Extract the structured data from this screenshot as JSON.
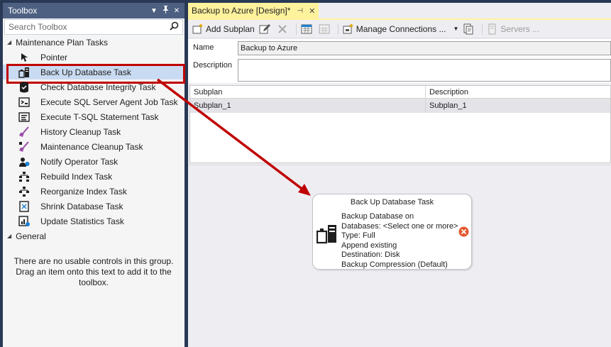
{
  "toolbox": {
    "title": "Toolbox",
    "search_placeholder": "Search Toolbox",
    "groups": [
      {
        "label": "Maintenance Plan Tasks",
        "items": [
          {
            "label": "Pointer",
            "icon": "pointer-icon"
          },
          {
            "label": "Back Up Database Task",
            "icon": "backup-database-icon",
            "selected": true
          },
          {
            "label": "Check Database Integrity Task",
            "icon": "check-integrity-icon"
          },
          {
            "label": "Execute SQL Server Agent Job Task",
            "icon": "agent-job-icon"
          },
          {
            "label": "Execute T-SQL Statement Task",
            "icon": "tsql-statement-icon"
          },
          {
            "label": "History Cleanup Task",
            "icon": "history-cleanup-icon"
          },
          {
            "label": "Maintenance Cleanup Task",
            "icon": "maintenance-cleanup-icon"
          },
          {
            "label": "Notify Operator Task",
            "icon": "notify-operator-icon"
          },
          {
            "label": "Rebuild Index Task",
            "icon": "rebuild-index-icon"
          },
          {
            "label": "Reorganize Index Task",
            "icon": "reorganize-index-icon"
          },
          {
            "label": "Shrink Database Task",
            "icon": "shrink-database-icon"
          },
          {
            "label": "Update Statistics Task",
            "icon": "update-statistics-icon"
          }
        ]
      },
      {
        "label": "General",
        "empty_message": "There are no usable controls in this group. Drag an item onto this text to add it to the toolbox."
      }
    ]
  },
  "designer": {
    "tab_title": "Backup to Azure [Design]*",
    "toolbar": {
      "add_subplan": "Add Subplan",
      "manage_connections": "Manage Connections ...",
      "servers": "Servers ..."
    },
    "name_label": "Name",
    "name_value": "Backup to Azure",
    "description_label": "Description",
    "description_value": "",
    "grid": {
      "columns": [
        "Subplan",
        "Description"
      ],
      "rows": [
        [
          "Subplan_1",
          "Subplan_1"
        ]
      ]
    },
    "task": {
      "title": "Back Up Database Task",
      "lines": [
        "Backup Database on",
        "Databases: <Select one or more>",
        "Type: Full",
        "Append existing",
        "Destination: Disk",
        "Backup Compression (Default)"
      ],
      "status": "error"
    }
  },
  "colors": {
    "highlight": "#c00000",
    "tab_active": "#fff29d",
    "titlebar": "#4d6082",
    "error": "#e4572e"
  }
}
